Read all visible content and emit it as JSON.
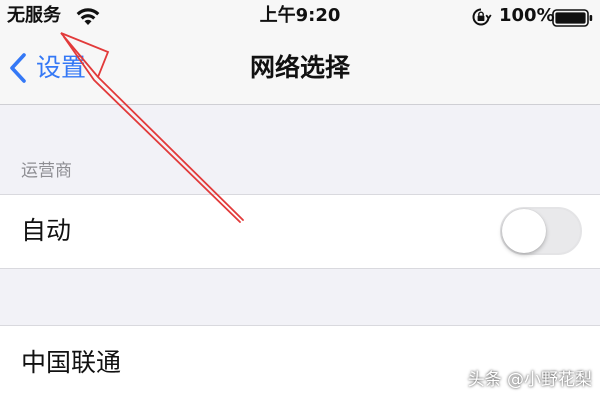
{
  "status_bar": {
    "carrier": "无服务",
    "time": "上午9:20",
    "battery_percent": "100%",
    "icons": [
      "wifi-icon",
      "orientation-lock-icon",
      "battery-icon"
    ]
  },
  "nav": {
    "back_label": "设置",
    "title": "网络选择",
    "accent_color": "#3478f6"
  },
  "carrier_section": {
    "header": "运营商",
    "auto_row": {
      "label": "自动",
      "toggle_on": false
    },
    "networks": [
      {
        "label": "中国联通"
      }
    ]
  },
  "watermark": "头条 @小野花梨",
  "annotation": {
    "type": "arrow",
    "color": "#e23a3a"
  }
}
